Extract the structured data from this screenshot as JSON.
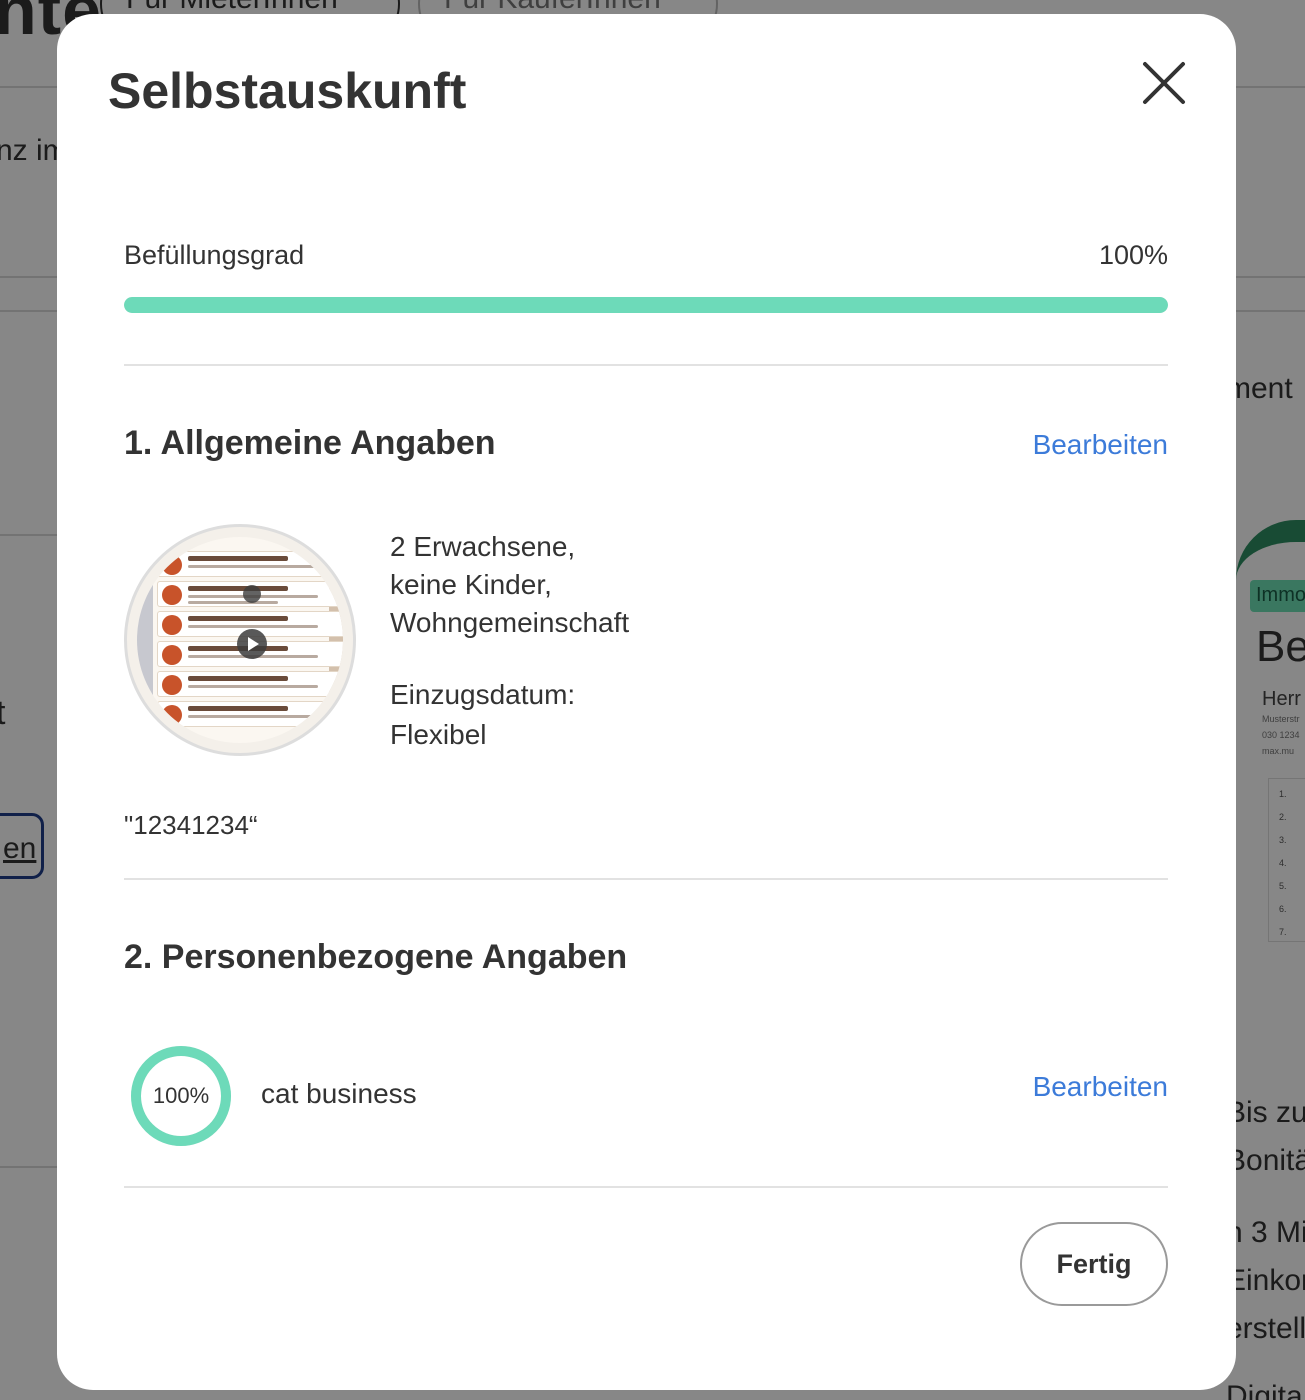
{
  "background": {
    "heading_fragment": "nte",
    "pill_1": "Für MieterInnen",
    "pill_2": "Für KäuferInnen",
    "left_fragment_1": "nz im",
    "left_fragment_2": "t",
    "left_link_fragment": "en",
    "right_fragment_1": "ment",
    "right_badge": "Immo",
    "right_big": "Be",
    "right_small": "Herr",
    "right_tiny_1": "Musterstr",
    "right_tiny_2": "030 1234",
    "right_tiny_3": "max.mu",
    "right_fragment_2": "Bis zu",
    "right_fragment_3": "Bonitä",
    "right_fragment_4": "n 3 Mi",
    "right_fragment_5": "Einkor",
    "right_fragment_6": "erstell",
    "right_fragment_7": "Digita"
  },
  "modal": {
    "title": "Selbstauskunft",
    "close_icon": "close-icon"
  },
  "progress": {
    "label": "Befüllungsgrad",
    "value_text": "100%",
    "value": 1.0,
    "color": "#6ddab9"
  },
  "section1": {
    "title": "1. Allgemeine Angaben",
    "edit_label": "Bearbeiten",
    "household_line1": "2 Erwachsene,",
    "household_line2": "keine Kinder,",
    "household_line3": "Wohngemeinschaft",
    "move_in_label": "Einzugsdatum:",
    "move_in_value": "Flexibel",
    "quote": "\"12341234“"
  },
  "section2": {
    "title": "2. Personenbezogene Angaben",
    "edit_label": "Bearbeiten",
    "ring_text": "100%",
    "ring_value": 1.0,
    "ring_color": "#6ddab9",
    "person_name": "cat business"
  },
  "footer": {
    "done_label": "Fertig"
  },
  "colors": {
    "link": "#3c7bd9",
    "accent": "#6ddab9",
    "text": "#333333"
  }
}
